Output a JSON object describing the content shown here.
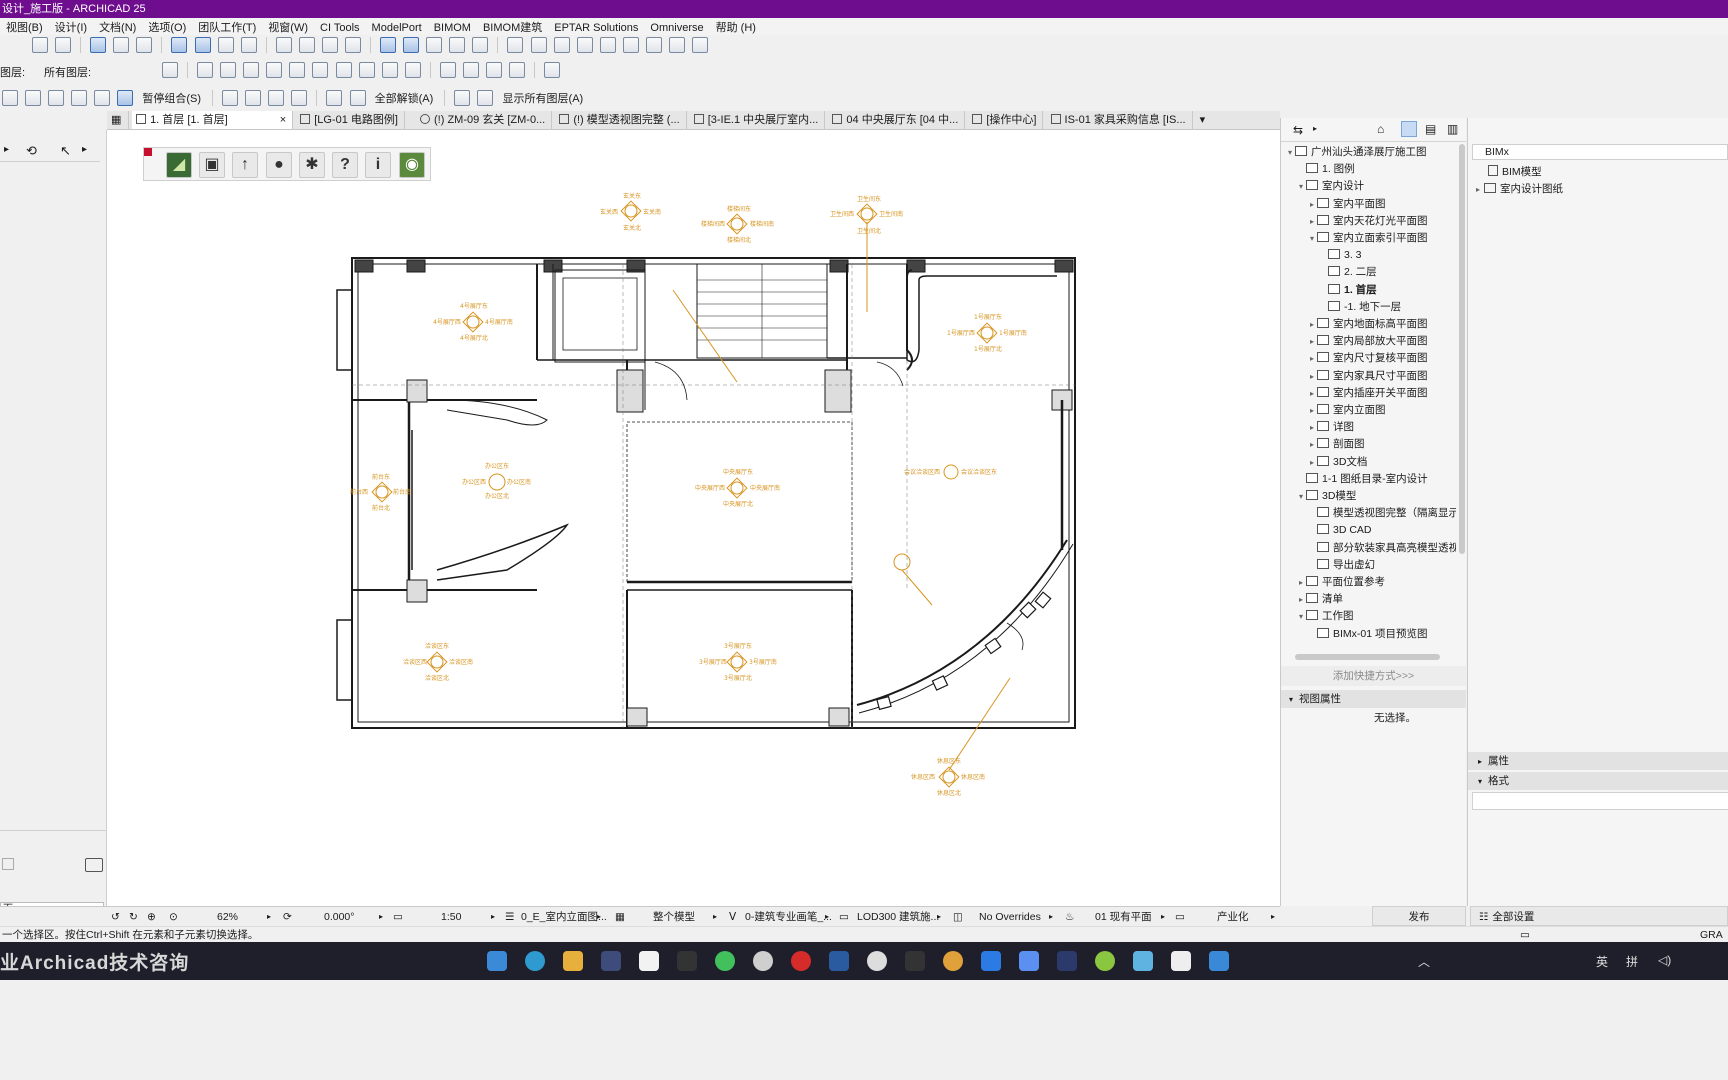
{
  "window": {
    "title": "设计_施工版 - ARCHICAD 25"
  },
  "menu": [
    "视图(B)",
    "设计(I)",
    "文档(N)",
    "选项(O)",
    "团队工作(T)",
    "视窗(W)",
    "CI Tools",
    "ModelPort",
    "BIMOM",
    "BIMOM建筑",
    "EPTAR Solutions",
    "Omniverse",
    "帮助 (H)"
  ],
  "toolbar2": {
    "layer_label": "图层:",
    "all_layers_label": "所有图层:"
  },
  "toolbar3": {
    "suspend_groups": "暂停组合(S)",
    "unlock_all": "全部解锁(A)",
    "show_all_layers": "显示所有图层(A)"
  },
  "tabs": [
    {
      "label": "1. 首层 [1. 首层]",
      "active": true,
      "close": "×"
    },
    {
      "label": "[LG-01 电路图例]"
    },
    {
      "label": "(!) ZM-09 玄关 [ZM-0..."
    },
    {
      "label": "(!) 模型透视图完整 (..."
    },
    {
      "label": "[3-IE.1 中央展厅室内..."
    },
    {
      "label": "04 中央展厅东 [04 中..."
    },
    {
      "label": "[操作中心]"
    },
    {
      "label": "IS-01 家具采购信息 [IS..."
    }
  ],
  "palette_buttons": [
    "export-icon",
    "save-icon",
    "upload-icon",
    "user-icon",
    "settings-icon",
    "help-icon",
    "info-icon",
    "bimx-icon"
  ],
  "plan_labels": {
    "tag_1": [
      "玄关东",
      "玄关南",
      "玄关西",
      "玄关北"
    ],
    "tag_2": [
      "楼梯间东",
      "楼梯间南",
      "楼梯间西",
      "楼梯间北"
    ],
    "tag_3": [
      "卫生间东",
      "卫生间南",
      "卫生间西",
      "卫生间北"
    ],
    "tag_4": [
      "4号展厅东",
      "4号展厅南",
      "4号展厅西",
      "4号展厅北"
    ],
    "tag_5": [
      "1号展厅东",
      "1号展厅南",
      "1号展厅西",
      "1号展厅北"
    ],
    "tag_6": [
      "办公区东",
      "办公区南",
      "办公区西",
      "办公区北"
    ],
    "tag_7": [
      "中央展厅东",
      "中央展厅南",
      "中央展厅西",
      "中央展厅北"
    ],
    "tag_8": [
      "前台东",
      "前台南",
      "前台西",
      "前台北"
    ],
    "tag_9": [
      "会议洽谈区东",
      "会议洽谈区西"
    ],
    "tag_10": [
      "洽谈区东",
      "洽谈区南",
      "洽谈区西",
      "洽谈区北"
    ],
    "tag_11": [
      "3号展厅东",
      "3号展厅南",
      "3号展厅西",
      "3号展厅北"
    ],
    "tag_12": [
      "休息区东",
      "休息区南",
      "休息区西",
      "休息区北"
    ]
  },
  "navigator": {
    "rows": [
      {
        "level": 0,
        "text": "广州汕头通泽展厅施工图",
        "open": true
      },
      {
        "level": 1,
        "text": "1. 图例"
      },
      {
        "level": 1,
        "text": "室内设计",
        "open": true
      },
      {
        "level": 2,
        "text": "室内平面图",
        "closed": true
      },
      {
        "level": 2,
        "text": "室内天花灯光平面图",
        "closed": true
      },
      {
        "level": 2,
        "text": "室内立面索引平面图",
        "open": true
      },
      {
        "level": 3,
        "text": "3. 3"
      },
      {
        "level": 3,
        "text": "2. 二层"
      },
      {
        "level": 3,
        "text": "1. 首层",
        "bold": true
      },
      {
        "level": 3,
        "text": "-1. 地下一层"
      },
      {
        "level": 2,
        "text": "室内地面标高平面图",
        "closed": true
      },
      {
        "level": 2,
        "text": "室内局部放大平面图",
        "closed": true
      },
      {
        "level": 2,
        "text": "室内尺寸复核平面图",
        "closed": true
      },
      {
        "level": 2,
        "text": "室内家具尺寸平面图",
        "closed": true
      },
      {
        "level": 2,
        "text": "室内插座开关平面图",
        "closed": true
      },
      {
        "level": 2,
        "text": "室内立面图",
        "closed": true
      },
      {
        "level": 2,
        "text": "详图",
        "closed": true
      },
      {
        "level": 2,
        "text": "剖面图",
        "closed": true
      },
      {
        "level": 2,
        "text": "3D文档",
        "closed": true
      },
      {
        "level": 1,
        "text": "1-1 图纸目录-室内设计"
      },
      {
        "level": 1,
        "text": "3D模型",
        "open": true
      },
      {
        "level": 2,
        "text": "模型透视图完整（隔离显示）"
      },
      {
        "level": 2,
        "text": "3D CAD"
      },
      {
        "level": 2,
        "text": "部分软装家具高亮模型透视图"
      },
      {
        "level": 2,
        "text": "导出虚幻"
      },
      {
        "level": 1,
        "text": "平面位置参考",
        "closed": true
      },
      {
        "level": 1,
        "text": "清单",
        "closed": true
      },
      {
        "level": 1,
        "text": "工作图",
        "open": true
      },
      {
        "level": 2,
        "text": "BIMx-01 项目预览图"
      }
    ],
    "add_shortcut": "添加快捷方式>>>",
    "view_props_title": "视图属性",
    "no_selection": "无选择。"
  },
  "bimx": {
    "title": "BIMx",
    "items": [
      "BIM模型",
      "室内设计图纸"
    ],
    "section_properties": "属性",
    "section_format": "格式",
    "publish": "发布",
    "all_settings": "全部设置"
  },
  "status": {
    "zoom": "62%",
    "angle": "0.000°",
    "scale": "1:50",
    "layer_combo": "0_E_室内立面图...",
    "model_view": "整个模型",
    "pen_set": "0-建筑专业画笔_...",
    "mvo": "LOD300 建筑施...",
    "overrides": "No Overrides",
    "renovation": "01 现有平面",
    "dim": "产业化"
  },
  "hint": "一个选择区。按住Ctrl+Shift 在元素和子元素切换选择。",
  "watermark": "业Archicad技术咨询",
  "taskbar": {
    "lang1": "英",
    "lang2": "拼",
    "gra": "GRA"
  }
}
